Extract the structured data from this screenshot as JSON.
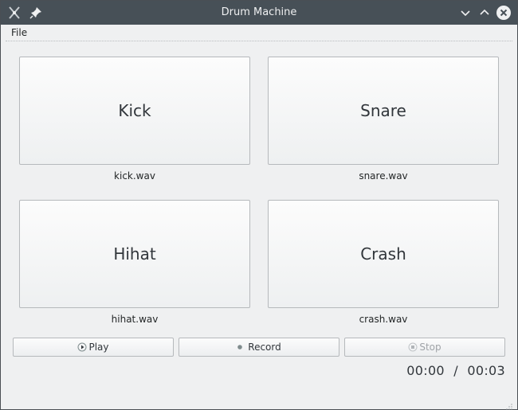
{
  "window": {
    "title": "Drum Machine",
    "icons": [
      "app-icon",
      "pin-icon",
      "minimize-icon",
      "maximize-icon",
      "close-icon"
    ]
  },
  "menu": {
    "file": "File"
  },
  "pads": [
    {
      "label": "Kick",
      "file": "kick.wav"
    },
    {
      "label": "Snare",
      "file": "snare.wav"
    },
    {
      "label": "Hihat",
      "file": "hihat.wav"
    },
    {
      "label": "Crash",
      "file": "crash.wav"
    }
  ],
  "controls": {
    "play": {
      "label": "Play",
      "icon": "play-icon",
      "enabled": true
    },
    "record": {
      "label": "Record",
      "icon": "record-icon",
      "enabled": true
    },
    "stop": {
      "label": "Stop",
      "icon": "stop-icon",
      "enabled": false
    }
  },
  "time": {
    "elapsed": "00:00",
    "separator": "/",
    "total": "00:03"
  },
  "colors": {
    "titlebar": "#475057",
    "window_bg": "#eff0f1",
    "text": "#31363b",
    "disabled_text": "#a0a4a8"
  }
}
